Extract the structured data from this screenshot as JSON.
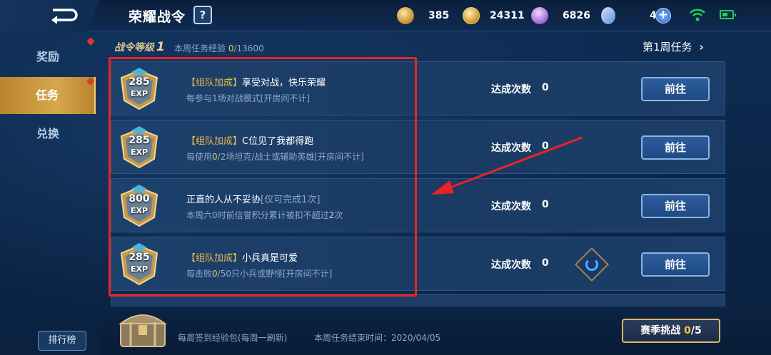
{
  "topbar": {
    "title": "荣耀战令",
    "help_label": "?",
    "resources": [
      {
        "icon": "token-icon",
        "value": "385"
      },
      {
        "icon": "gold-coin-icon",
        "value": "24311"
      },
      {
        "icon": "diamond-icon",
        "value": "6826"
      },
      {
        "icon": "card-icon",
        "value": "4"
      }
    ],
    "plus_label": "+"
  },
  "sidebar": {
    "items": [
      {
        "label": "奖励",
        "active": false
      },
      {
        "label": "任务",
        "active": true
      },
      {
        "label": "兑换",
        "active": false
      }
    ],
    "rank_label": "排行榜"
  },
  "header": {
    "level_label": "战令等级",
    "level_value": "1",
    "week_exp_label": "本周任务经验",
    "week_exp_current": "0",
    "week_exp_total": "/13600",
    "week_tasks_label": "第1周任务"
  },
  "tasks": [
    {
      "exp": "285",
      "exp_label": "EXP",
      "tag": "【组队加成】",
      "title": "享受对战，快乐荣耀",
      "note": "",
      "desc": "每参与1场对战模式[开房间不计]",
      "count_label": "达成次数",
      "count": "0",
      "button": "前往"
    },
    {
      "exp": "285",
      "exp_label": "EXP",
      "tag": "【组队加成】",
      "title": "C位见了我都得跑",
      "note": "",
      "desc_pre": "每使用",
      "desc_hl": "0",
      "desc_post": "/2场坦克/战士或辅助英雄[开房间不计]",
      "count_label": "达成次数",
      "count": "0",
      "button": "前往"
    },
    {
      "exp": "800",
      "exp_label": "EXP",
      "tag": "",
      "title": "正直的人从不妥协",
      "note": "[仅可完成1次]",
      "desc_pre": "本周六0时前信誉积分累计被扣不超过",
      "desc_hl": "2",
      "desc_post": "次",
      "count_label": "达成次数",
      "count": "0",
      "button": "前往"
    },
    {
      "exp": "285",
      "exp_label": "EXP",
      "tag": "【组队加成】",
      "title": "小兵真是可爱",
      "note": "",
      "desc_pre": "每击败",
      "desc_hl": "0",
      "desc_post": "/50只小兵或野怪[开房间不计]",
      "count_label": "达成次数",
      "count": "0",
      "button": "前往"
    }
  ],
  "footer": {
    "weekly_bag": "每周签到经验包(每周一刷新)",
    "task_end": "本周任务结束时间：2020/04/05",
    "season_label": "赛季挑战",
    "season_progress": "0",
    "season_total": "/5"
  },
  "colors": {
    "accent_gold": "#eab949",
    "highlight_red": "#ea2323",
    "button_blue": "#1f4a84"
  }
}
